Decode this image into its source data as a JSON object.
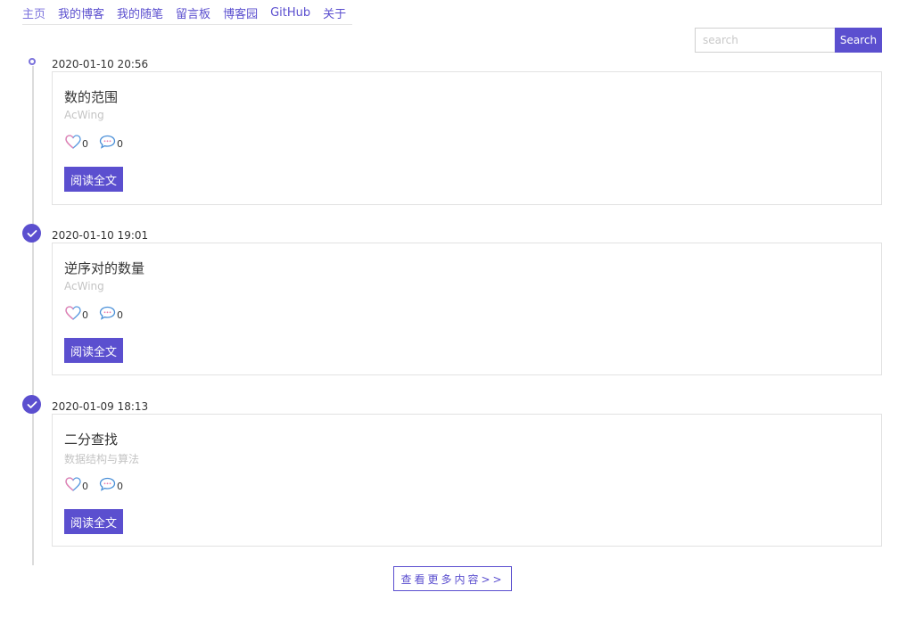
{
  "nav": {
    "items": [
      "主页",
      "我的博客",
      "我的随笔",
      "留言板",
      "博客园",
      "GitHub",
      "关于"
    ]
  },
  "search": {
    "placeholder": "search",
    "button_label": "Search"
  },
  "posts": [
    {
      "date": "2020-01-10 20:56",
      "title": "数的范围",
      "source": "AcWing",
      "likes": "0",
      "comments": "0",
      "read_label": "阅读全文"
    },
    {
      "date": "2020-01-10 19:01",
      "title": "逆序对的数量",
      "source": "AcWing",
      "likes": "0",
      "comments": "0",
      "read_label": "阅读全文"
    },
    {
      "date": "2020-01-09 18:13",
      "title": "二分查找",
      "source": "数据结构与算法",
      "likes": "0",
      "comments": "0",
      "read_label": "阅读全文"
    }
  ],
  "more_label": "查看更多内容>>",
  "colors": {
    "accent": "#5b4fcf",
    "heart_pink": "#e97fb0",
    "heart_blue": "#5a9be0",
    "comment_blue": "#4a8fd8"
  },
  "icons": {
    "like": "heart-icon",
    "comment": "comment-icon",
    "check": "check-icon"
  }
}
